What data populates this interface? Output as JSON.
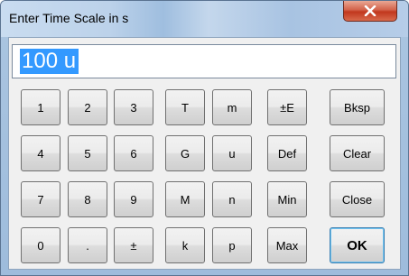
{
  "window": {
    "title": "Enter Time Scale in s"
  },
  "entry": {
    "value": "100 u"
  },
  "keys": {
    "k1": "1",
    "k2": "2",
    "k3": "3",
    "k4": "4",
    "k5": "5",
    "k6": "6",
    "k7": "7",
    "k8": "8",
    "k9": "9",
    "k0": "0",
    "dot": ".",
    "sign": "±",
    "T": "T",
    "m": "m",
    "G": "G",
    "u": "u",
    "M": "M",
    "n": "n",
    "k": "k",
    "p": "p",
    "exp": "±E",
    "def": "Def",
    "min": "Min",
    "max": "Max",
    "bksp": "Bksp",
    "clear": "Clear",
    "close": "Close",
    "ok": "OK"
  },
  "icons": {
    "close": "close-x-icon"
  },
  "colors": {
    "selection": "#3399ff",
    "close_button": "#c1371d",
    "ok_focus": "#3c7fb1"
  }
}
